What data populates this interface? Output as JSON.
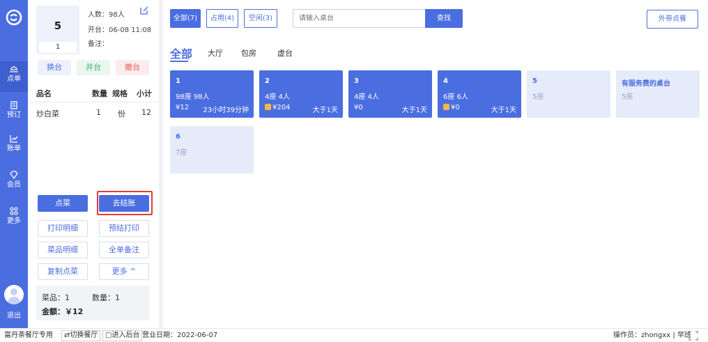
{
  "nav": {
    "items": [
      {
        "label": "点单",
        "icon": "order-icon"
      },
      {
        "label": "预订",
        "icon": "reserve-icon"
      },
      {
        "label": "账单",
        "icon": "bill-chart-icon"
      },
      {
        "label": "会员",
        "icon": "member-diamond-icon"
      },
      {
        "label": "更多",
        "icon": "more-grid-icon"
      }
    ],
    "exit_label": "退出"
  },
  "order": {
    "table_number": "5",
    "sub_count": "1",
    "people": "人数：98人",
    "opened": "开台：06-08 11:08",
    "remark": "备注：",
    "actions": {
      "change": "换台",
      "merge": "并台",
      "cancel": "撤台"
    },
    "columns": {
      "name": "品名",
      "qty": "数量",
      "spec": "规格",
      "subtotal": "小计"
    },
    "items": [
      {
        "name": "炒白菜",
        "qty": "1",
        "spec": "份",
        "subtotal": "12"
      }
    ],
    "buttons": {
      "order": "点菜",
      "checkout": "去结账",
      "print_detail": "打印明细",
      "prepay_print": "预结打印",
      "dish_detail": "菜品明细",
      "order_remark": "全单备注",
      "copy_order": "复制点菜",
      "more": "更多 ^"
    },
    "summary": {
      "dishes": "菜品：1",
      "quantity": "数量：1",
      "amount": "金额：￥12"
    }
  },
  "main": {
    "filters": [
      {
        "label": "全部(7)",
        "active": true
      },
      {
        "label": "占用(4)",
        "active": false
      },
      {
        "label": "空闲(3)",
        "active": false
      }
    ],
    "search": {
      "placeholder": "请输入桌台",
      "button": "查找"
    },
    "takeout": "外带点餐",
    "areas": [
      {
        "label": "全部",
        "active": true
      },
      {
        "label": "大厅",
        "active": false
      },
      {
        "label": "包房",
        "active": false
      },
      {
        "label": "虚台",
        "active": false
      }
    ],
    "tables": [
      {
        "name": "1",
        "seats": "98座  98人",
        "price": "¥12",
        "time": "23小时39分钟",
        "status": "busy",
        "coin": false
      },
      {
        "name": "2",
        "seats": "4座  4人",
        "price": "¥204",
        "time": "大于1天",
        "status": "busy",
        "coin": true
      },
      {
        "name": "3",
        "seats": "4座  4人",
        "price": "¥0",
        "time": "大于1天",
        "status": "busy",
        "coin": false
      },
      {
        "name": "4",
        "seats": "6座  6人",
        "price": "¥0",
        "time": "大于1天",
        "status": "busy",
        "coin": true
      },
      {
        "name": "5",
        "seats": "5座",
        "price": "",
        "time": "",
        "status": "free",
        "coin": false
      },
      {
        "name": "有服务费的桌台",
        "seats": "5座",
        "price": "",
        "time": "",
        "status": "free",
        "coin": false
      },
      {
        "name": "6",
        "seats": "7座",
        "price": "",
        "time": "",
        "status": "free",
        "coin": false
      }
    ]
  },
  "footer": {
    "shop": "富丹荼餐厅专用",
    "switch": "⇄切换餐厅",
    "backend": "□进入后台",
    "business_date": "营业日期：2022-06-07",
    "operator": "操作员：zhongxx | 早班"
  },
  "colors": {
    "primary": "#4a6ee0",
    "free_card": "#e6ebfa",
    "highlight": "#e23a3a"
  }
}
